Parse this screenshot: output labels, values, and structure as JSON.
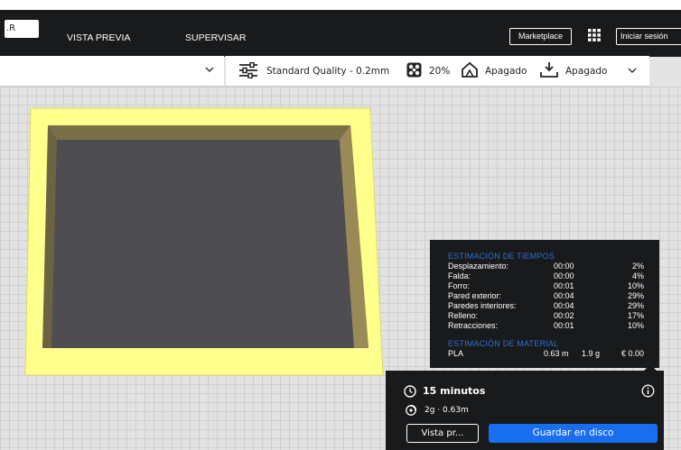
{
  "header": {
    "tab_prepare_fragment": ".R",
    "tab_preview": "VISTA PREVIA",
    "tab_monitor": "SUPERVISAR",
    "marketplace_label": "Marketplace",
    "signin_label": "Iniciar sesión"
  },
  "print_settings": {
    "profile": "Standard Quality - 0.2mm",
    "infill": "20%",
    "support": "Apagado",
    "adhesion": "Apagado"
  },
  "estimate": {
    "time_heading": "ESTIMACIÓN DE TIEMPOS",
    "rows": [
      {
        "label": "Desplazamiento:",
        "time": "00:00",
        "pct": "2%"
      },
      {
        "label": "Falda:",
        "time": "00:00",
        "pct": "4%"
      },
      {
        "label": "Forro:",
        "time": "00:01",
        "pct": "10%"
      },
      {
        "label": "Pared exterior:",
        "time": "00:04",
        "pct": "29%"
      },
      {
        "label": "Paredes interiores:",
        "time": "00:04",
        "pct": "29%"
      },
      {
        "label": "Relleno:",
        "time": "00:02",
        "pct": "17%"
      },
      {
        "label": "Retracciones:",
        "time": "00:01",
        "pct": "10%"
      }
    ],
    "material_heading": "ESTIMACIÓN DE MATERIAL",
    "material": {
      "name": "PLA",
      "length": "0.63 m",
      "weight": "1.9 g",
      "cost": "€ 0.00"
    }
  },
  "action": {
    "print_time": "15 minutos",
    "material_summary": "2g · 0.63m",
    "preview_button": "Vista pr...",
    "save_button": "Guardar en disco"
  },
  "colors": {
    "accent": "#196ef0",
    "heading_blue": "#2b6fd6",
    "model_yellow": "#ffff88",
    "dark_panel": "#191a1c"
  }
}
